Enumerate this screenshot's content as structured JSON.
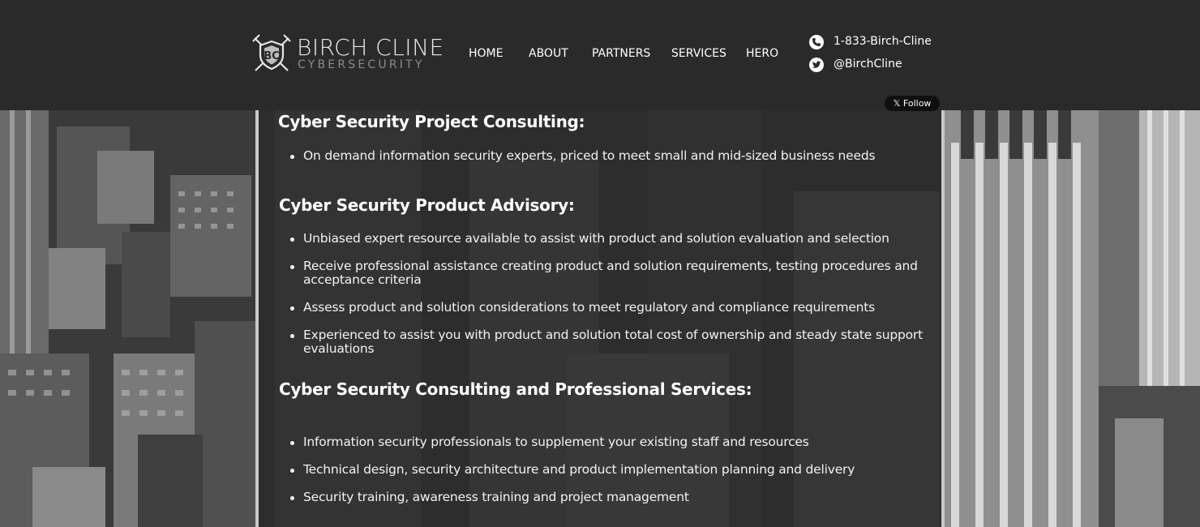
{
  "brand": {
    "name": "BIRCH CLINE",
    "tagline": "CYBERSECURITY"
  },
  "nav": {
    "items": [
      "HOME",
      "ABOUT",
      "PARTNERS",
      "SERVICES",
      "HERO"
    ]
  },
  "contact": {
    "phone": "1-833-Birch-Cline",
    "twitter": "@BirchCline",
    "phone_icon": "phone-icon",
    "twitter_icon": "twitter-icon"
  },
  "follow_button": "𝕏 Follow",
  "sections": [
    {
      "title": "Cyber Security Project Consulting:",
      "bullets": [
        "On demand information security experts, priced to meet small and mid-sized business needs"
      ]
    },
    {
      "title": "Cyber Security Product Advisory:",
      "bullets": [
        "Unbiased expert resource available to assist with product and solution evaluation and selection",
        "Receive professional assistance creating product and solution requirements, testing procedures and acceptance criteria",
        "Assess product and solution considerations to meet regulatory and compliance requirements",
        "Experienced to assist you with product and solution total cost of ownership and steady state support evaluations"
      ]
    },
    {
      "title": "Cyber Security Consulting and Professional Services:",
      "bullets": [
        "Information security professionals to supplement your existing staff and resources",
        "Technical design, security architecture and product implementation planning and delivery",
        "Security training, awareness training and project management"
      ]
    }
  ],
  "colors": {
    "header_bg": "#2a2a2a",
    "content_bg": "#2e2e2e",
    "text": "#ffffff",
    "tagline": "#8a8a8a"
  }
}
